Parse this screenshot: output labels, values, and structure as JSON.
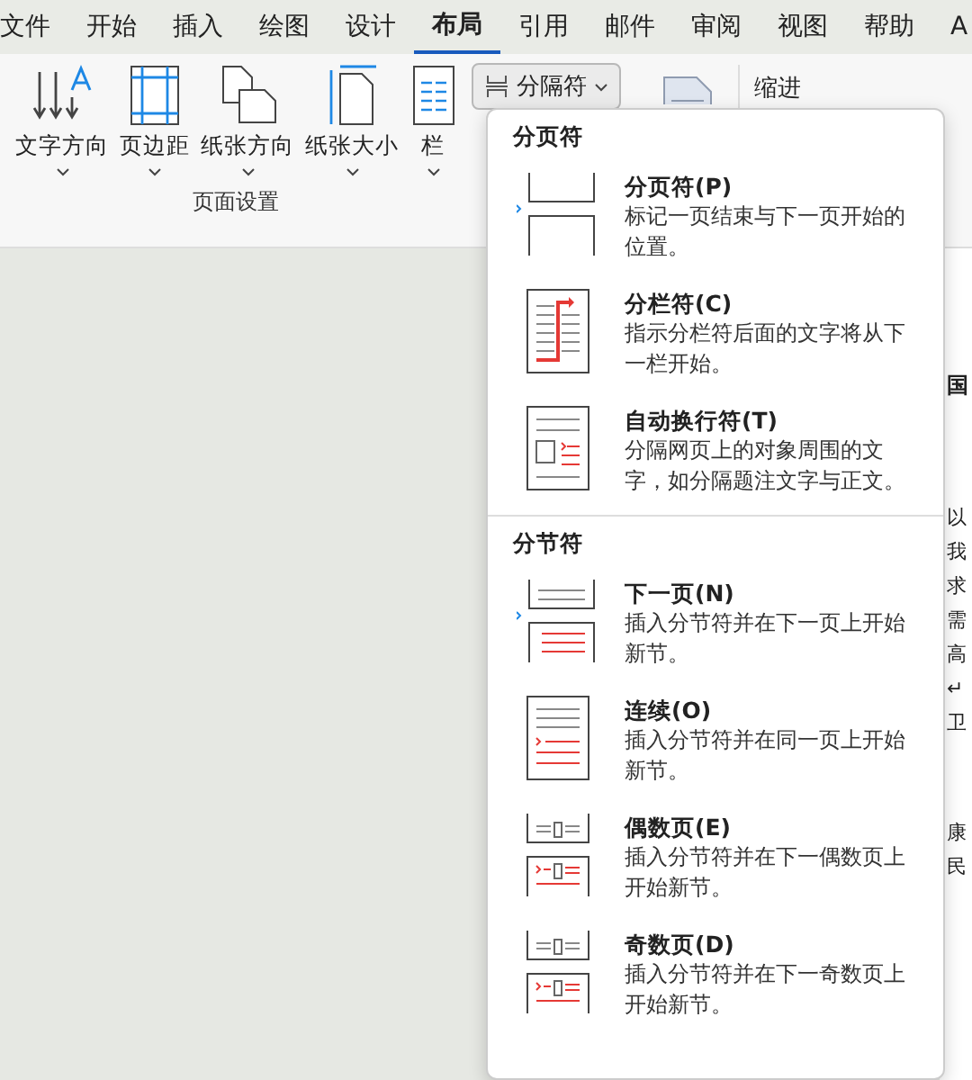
{
  "tabs": [
    {
      "label": "文件",
      "selected": false
    },
    {
      "label": "开始",
      "selected": false
    },
    {
      "label": "插入",
      "selected": false
    },
    {
      "label": "绘图",
      "selected": false
    },
    {
      "label": "设计",
      "selected": false
    },
    {
      "label": "布局",
      "selected": true
    },
    {
      "label": "引用",
      "selected": false
    },
    {
      "label": "邮件",
      "selected": false
    },
    {
      "label": "审阅",
      "selected": false
    },
    {
      "label": "视图",
      "selected": false
    },
    {
      "label": "帮助",
      "selected": false
    },
    {
      "label": "A",
      "selected": false
    }
  ],
  "ribbon": {
    "buttons": [
      {
        "label": "文字方向"
      },
      {
        "label": "页边距"
      },
      {
        "label": "纸张方向"
      },
      {
        "label": "纸张大小"
      },
      {
        "label": "栏"
      }
    ],
    "group_label": "页面设置",
    "breaks_button": "分隔符",
    "indent_label": "缩进"
  },
  "menu": {
    "sections": [
      {
        "title": "分页符",
        "items": [
          {
            "title": "分页符(P)",
            "description": "标记一页结束与下一页开始的位置。"
          },
          {
            "title": "分栏符(C)",
            "description": "指示分栏符后面的文字将从下一栏开始。"
          },
          {
            "title": "自动换行符(T)",
            "description": "分隔网页上的对象周围的文字，如分隔题注文字与正文。"
          }
        ]
      },
      {
        "title": "分节符",
        "items": [
          {
            "title": "下一页(N)",
            "description": "插入分节符并在下一页上开始新节。"
          },
          {
            "title": "连续(O)",
            "description": "插入分节符并在同一页上开始新节。"
          },
          {
            "title": "偶数页(E)",
            "description": "插入分节符并在下一偶数页上开始新节。"
          },
          {
            "title": "奇数页(D)",
            "description": "插入分节符并在下一奇数页上开始新节。"
          }
        ]
      }
    ]
  },
  "document": {
    "lines": [
      "国",
      "以",
      "我",
      "求",
      "需",
      "高",
      "↵",
      "卫",
      "康",
      "民"
    ]
  }
}
